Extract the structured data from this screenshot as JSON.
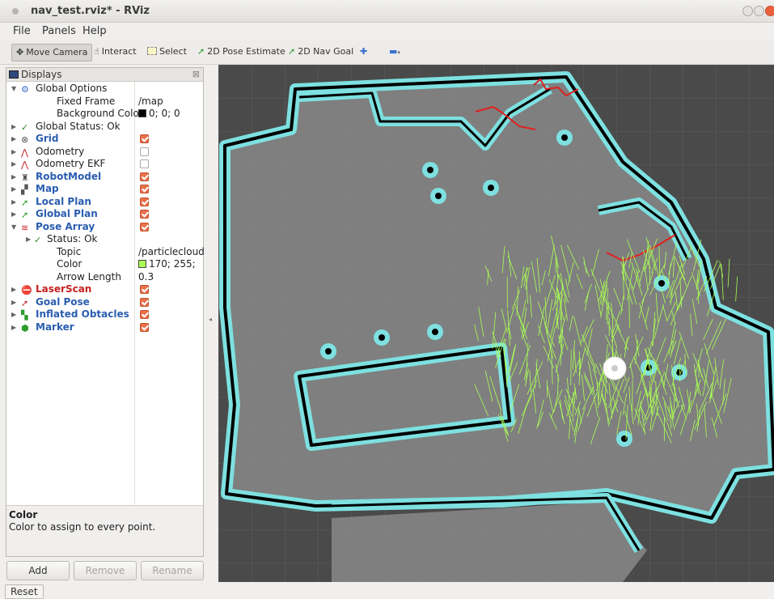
{
  "window": {
    "title": "nav_test.rviz* - RViz"
  },
  "menu": {
    "file": "File",
    "panels": "Panels",
    "help": "Help"
  },
  "toolbar": {
    "move_camera": "Move Camera",
    "interact": "Interact",
    "select": "Select",
    "pose_estimate": "2D Pose Estimate",
    "nav_goal": "2D Nav Goal"
  },
  "displays": {
    "title": "Displays",
    "global_options": "Global Options",
    "fixed_frame_label": "Fixed Frame",
    "fixed_frame_value": "/map",
    "background_color_label": "Background Color",
    "background_color_value": "0; 0; 0",
    "global_status": "Global Status: Ok",
    "items": [
      {
        "name": "Grid",
        "checked": true
      },
      {
        "name": "Odometry",
        "checked": false
      },
      {
        "name": "Odometry EKF",
        "checked": false
      },
      {
        "name": "RobotModel",
        "checked": true
      },
      {
        "name": "Map",
        "checked": true
      },
      {
        "name": "Local Plan",
        "checked": true
      },
      {
        "name": "Global Plan",
        "checked": true
      },
      {
        "name": "Pose Array",
        "checked": true
      },
      {
        "name": "LaserScan",
        "checked": true
      },
      {
        "name": "Goal Pose",
        "checked": true
      },
      {
        "name": "Inflated Obtacles",
        "checked": true
      },
      {
        "name": "Marker",
        "checked": true
      }
    ],
    "pose_array": {
      "status": "Status: Ok",
      "topic_label": "Topic",
      "topic_value": "/particlecloud",
      "color_label": "Color",
      "color_value": "170; 255;",
      "arrow_length_label": "Arrow Length",
      "arrow_length_value": "0.3"
    }
  },
  "description": {
    "title": "Color",
    "text": "Color to assign to every point."
  },
  "buttons": {
    "add": "Add",
    "remove": "Remove",
    "rename": "Rename",
    "reset": "Reset"
  },
  "colors": {
    "map_free": "#7f7f7f",
    "map_unknown": "#4a4a4a",
    "obstacle": "#000000",
    "inflated": "#7ee0e0",
    "particles": "#aaff55",
    "laser": "#e02020",
    "checkbox_on": "#e8704a"
  }
}
